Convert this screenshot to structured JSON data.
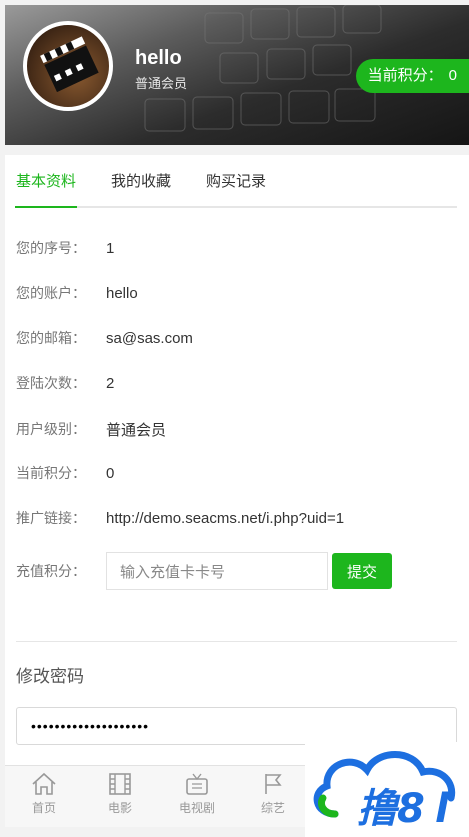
{
  "header": {
    "username": "hello",
    "level": "普通会员",
    "points_label": "当前积分：",
    "points_value": "0"
  },
  "tabs": [
    {
      "label": "基本资料",
      "active": true
    },
    {
      "label": "我的收藏",
      "active": false
    },
    {
      "label": "购买记录",
      "active": false
    }
  ],
  "profile": {
    "serial_label": "您的序号：",
    "serial_value": "1",
    "account_label": "您的账户：",
    "account_value": "hello",
    "email_label": "您的邮箱：",
    "email_value": "sa@sas.com",
    "login_label": "登陆次数：",
    "login_value": "2",
    "level_label": "用户级别：",
    "level_value": "普通会员",
    "points_label": "当前积分：",
    "points_value": "0",
    "promo_label": "推广链接：",
    "promo_value": "http://demo.seacms.net/i.php?uid=1"
  },
  "recharge": {
    "label": "充值积分：",
    "placeholder": "输入充值卡卡号",
    "submit_label": "提交"
  },
  "password": {
    "title": "修改密码",
    "value": "••••••••••••••••••••"
  },
  "bottom_nav": [
    {
      "label": "首页",
      "icon": "home-icon"
    },
    {
      "label": "电影",
      "icon": "film-icon"
    },
    {
      "label": "电视剧",
      "icon": "tv-icon"
    },
    {
      "label": "综艺",
      "icon": "flag-icon"
    }
  ],
  "watermark": {
    "text": "撸8"
  },
  "colors": {
    "accent": "#1db61d",
    "watermark_blue": "#1d6fe0",
    "watermark_green": "#1db61d"
  }
}
